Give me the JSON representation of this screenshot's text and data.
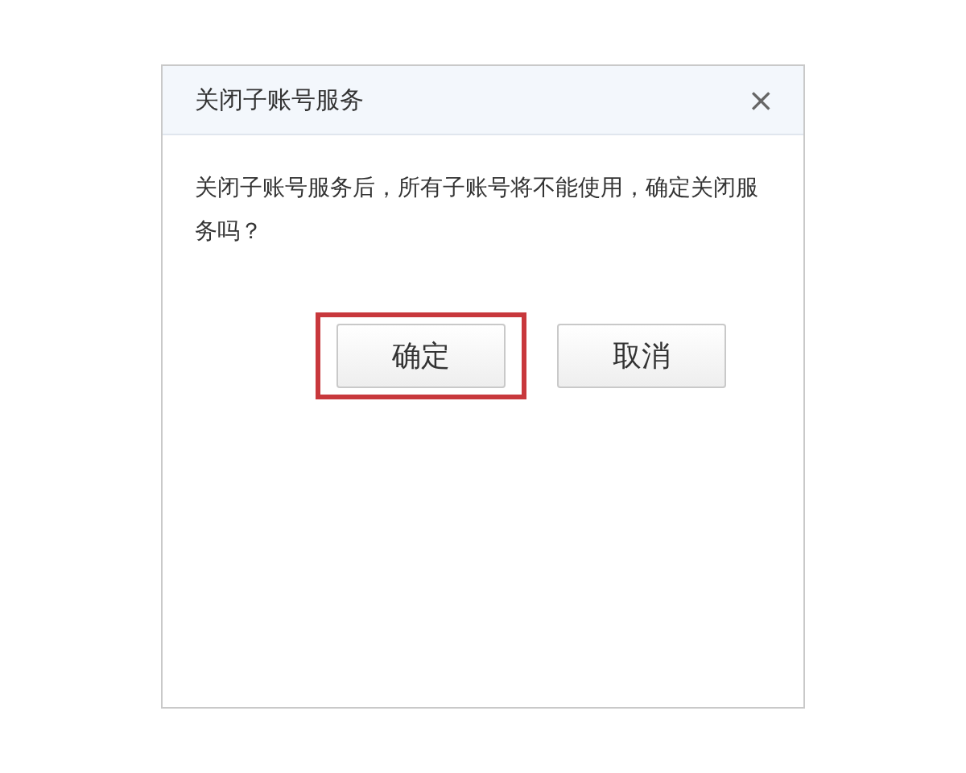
{
  "dialog": {
    "title": "关闭子账号服务",
    "close": "×",
    "message": "关闭子账号服务后，所有子账号将不能使用，确定关闭服务吗？",
    "buttons": [
      {
        "label": "确定",
        "highlighted": true
      },
      {
        "label": "取消",
        "highlighted": false
      }
    ]
  }
}
